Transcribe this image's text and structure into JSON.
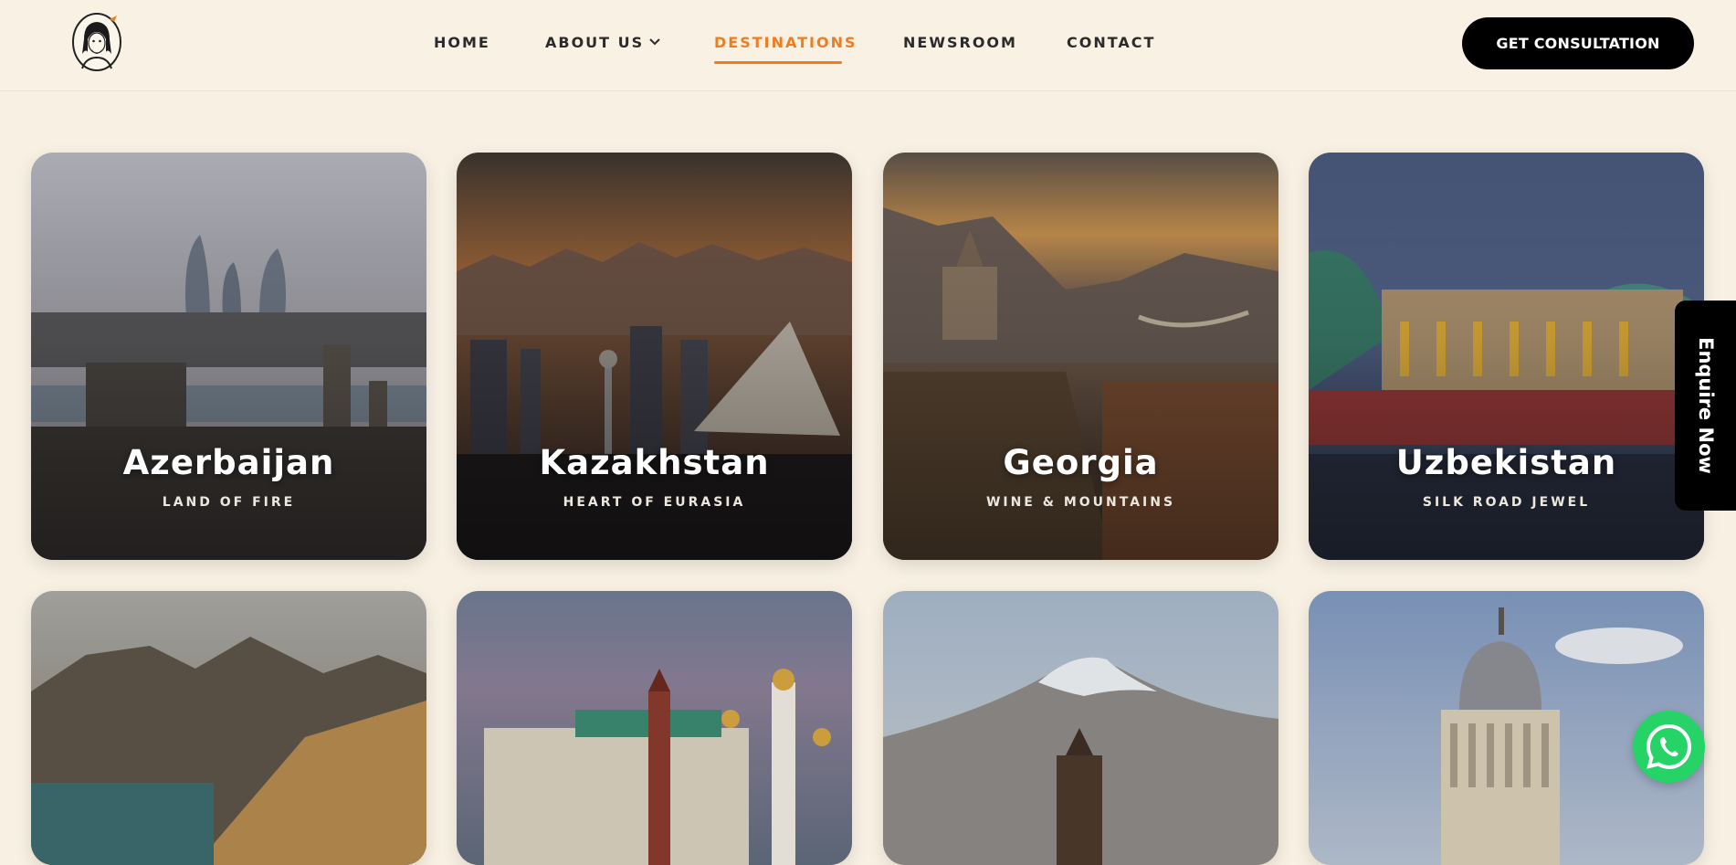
{
  "header": {
    "logo_alt": "Traveler logo",
    "nav": [
      {
        "label": "HOME"
      },
      {
        "label": "ABOUT US"
      },
      {
        "label": "DESTINATIONS"
      },
      {
        "label": "NEWSROOM"
      },
      {
        "label": "CONTACT"
      }
    ],
    "active_nav": "DESTINATIONS",
    "cta_label": "GET CONSULTATION"
  },
  "destinations": [
    {
      "name": "Azerbaijan",
      "tagline": "LAND OF FIRE"
    },
    {
      "name": "Kazakhstan",
      "tagline": "HEART OF EURASIA"
    },
    {
      "name": "Georgia",
      "tagline": "WINE & MOUNTAINS"
    },
    {
      "name": "Uzbekistan",
      "tagline": "SILK ROAD JEWEL"
    },
    {
      "name": "",
      "tagline": ""
    },
    {
      "name": "",
      "tagline": ""
    },
    {
      "name": "",
      "tagline": ""
    },
    {
      "name": "",
      "tagline": ""
    }
  ],
  "enquire_label": "Enquire Now",
  "whatsapp_icon": "whatsapp-icon",
  "colors": {
    "accent": "#f07c1e",
    "background": "#f8f1e3",
    "button": "#000000",
    "whatsapp": "#25d366"
  }
}
